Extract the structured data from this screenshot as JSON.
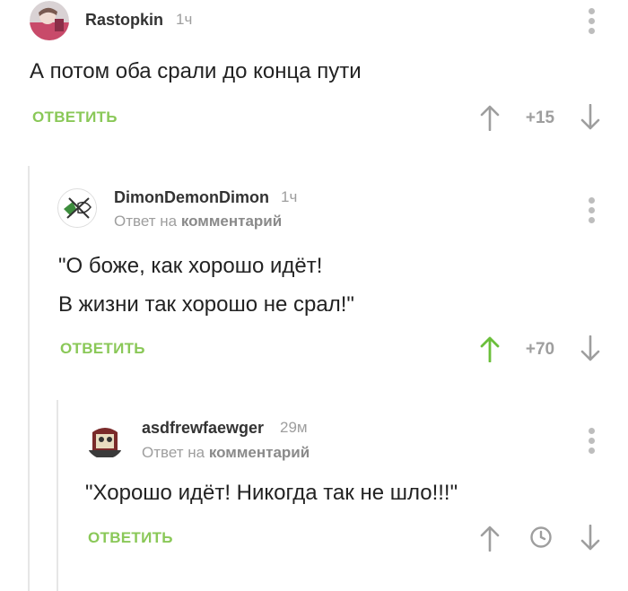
{
  "comments": [
    {
      "author": "Rastopkin",
      "time": "1ч",
      "text": "А потом оба срали до конца пути",
      "reply_label": "ОТВЕТИТЬ",
      "rating": "+15",
      "avatar": "user-photo"
    },
    {
      "author": "DimonDemonDimon",
      "time": "1ч",
      "reply_prefix": "Ответ на",
      "reply_target": "комментарий",
      "text_line1": "\"О боже, как хорошо идёт!",
      "text_line2": "В жизни так хорошо не срал!\"",
      "reply_label": "ОТВЕТИТЬ",
      "rating": "+70",
      "avatar": "crossed-cat-drawing"
    },
    {
      "author": "asdfrewfaewger",
      "time": "29м",
      "reply_prefix": "Ответ на",
      "reply_target": "комментарий",
      "text": "\"Хорошо идёт! Никогда так не шло!!!\"",
      "reply_label": "ОТВЕТИТЬ",
      "avatar": "cartoon-box-character"
    }
  ],
  "colors": {
    "accent_green": "#8ac858",
    "upvoted_green": "#6bbf3b",
    "muted_gray": "#9e9e9e",
    "thread_line": "#e6e6e6"
  },
  "icons": [
    "arrow-up-icon",
    "arrow-down-icon",
    "clock-icon",
    "more-vertical-icon"
  ]
}
